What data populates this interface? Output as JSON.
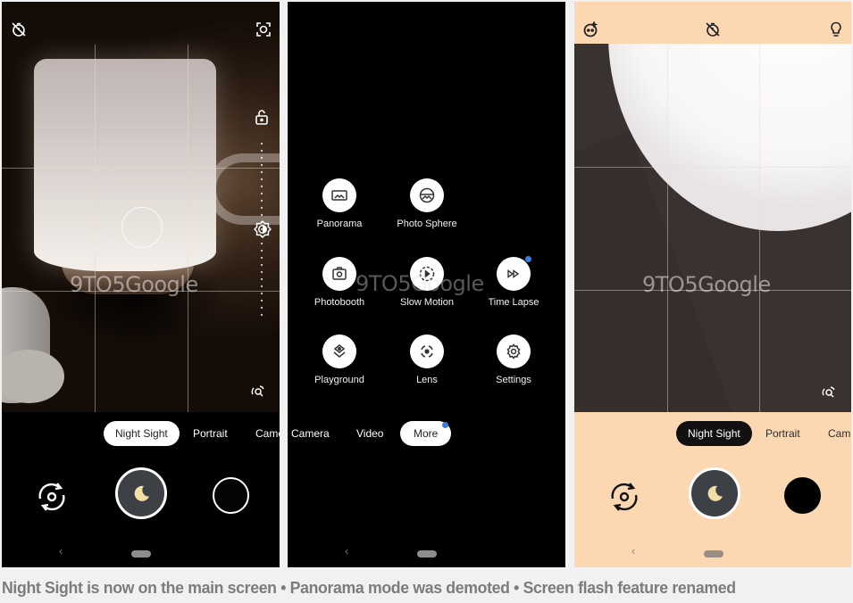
{
  "watermark": "9TO5Google",
  "caption": "Night Sight is now on the main screen • Panorama mode was demoted • Screen flash feature renamed",
  "colors": {
    "accent_badge": "#3a7be0",
    "light_theme_bg": "#fcd8b2",
    "shutter_fill": "#3d4045",
    "moon": "#f1dfa6"
  },
  "panel_1": {
    "top_icons": [
      "timer-off-icon",
      "face-retouch-icon"
    ],
    "side_icons": [
      "exposure-lock-icon",
      "brightness-icon",
      "zoom-icon"
    ],
    "modes": [
      {
        "label": "Night Sight",
        "selected": true
      },
      {
        "label": "Portrait",
        "selected": false
      },
      {
        "label": "Came",
        "selected": false
      }
    ],
    "shutter_icon": "moon-icon",
    "nav": {
      "back": "‹"
    }
  },
  "panel_2": {
    "more_items": [
      {
        "label": "Panorama",
        "icon": "panorama-icon",
        "badge": false
      },
      {
        "label": "Photo Sphere",
        "icon": "photo-sphere-icon",
        "badge": false
      },
      {
        "label": "Photobooth",
        "icon": "photobooth-icon",
        "badge": false
      },
      {
        "label": "Slow Motion",
        "icon": "slow-motion-icon",
        "badge": false
      },
      {
        "label": "Time Lapse",
        "icon": "time-lapse-icon",
        "badge": true
      },
      {
        "label": "Playground",
        "icon": "playground-icon",
        "badge": false
      },
      {
        "label": "Lens",
        "icon": "lens-icon",
        "badge": false
      },
      {
        "label": "Settings",
        "icon": "settings-icon",
        "badge": false
      }
    ],
    "modes": [
      {
        "label": "Camera",
        "selected": false
      },
      {
        "label": "Video",
        "selected": false
      },
      {
        "label": "More",
        "selected": true,
        "badge": true
      }
    ],
    "nav": {
      "back": "‹"
    }
  },
  "panel_3": {
    "top_icons": [
      "face-retouch-icon",
      "timer-off-icon",
      "screen-flash-icon"
    ],
    "side_icons": [
      "zoom-icon"
    ],
    "modes": [
      {
        "label": "Night Sight",
        "selected": true
      },
      {
        "label": "Portrait",
        "selected": false
      },
      {
        "label": "Came",
        "selected": false
      }
    ],
    "shutter_icon": "moon-icon",
    "nav": {
      "back": "‹"
    }
  }
}
